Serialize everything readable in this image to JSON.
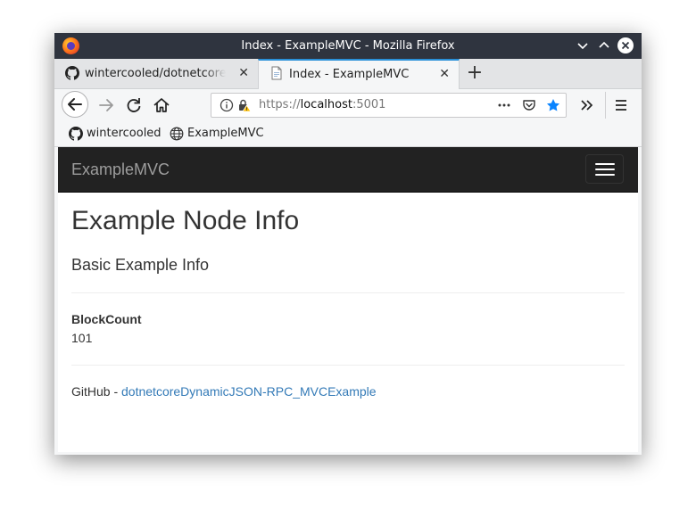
{
  "window": {
    "title": "Index - ExampleMVC - Mozilla Firefox"
  },
  "tabs": [
    {
      "label": "wintercooled/dotnetcoreDynamicJSON-RPC",
      "icon": "github-icon"
    },
    {
      "label": "Index - ExampleMVC",
      "icon": "page-icon",
      "active": true
    }
  ],
  "urlbar": {
    "scheme": "https://",
    "host": "localhost",
    "port": ":5001"
  },
  "bookmarks": [
    {
      "label": "wintercooled",
      "icon": "github-icon"
    },
    {
      "label": "ExampleMVC",
      "icon": "globe-icon"
    }
  ],
  "site": {
    "brand": "ExampleMVC",
    "heading": "Example Node Info",
    "subheading": "Basic Example Info",
    "field_label": "BlockCount",
    "field_value": "101",
    "footer_prefix": "GitHub - ",
    "footer_link": "dotnetcoreDynamicJSON-RPC_MVCExample"
  },
  "colors": {
    "titlebar": "#2f343f",
    "site_nav": "#222222",
    "link": "#337ab7",
    "active_tab_accent": "#2a90d8",
    "bookmark_star": "#0a84ff"
  }
}
